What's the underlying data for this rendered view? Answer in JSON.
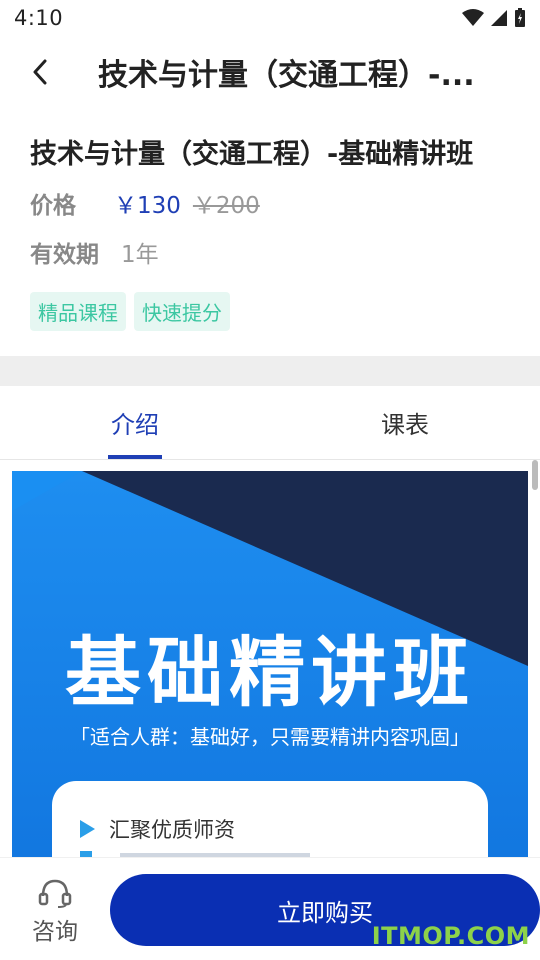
{
  "status": {
    "time": "4:10"
  },
  "nav": {
    "title": "技术与计量（交通工程）-..."
  },
  "course": {
    "title": "技术与计量（交通工程）-基础精讲班",
    "price_label": "价格",
    "price_now": "￥130",
    "price_old": "￥200",
    "validity_label": "有效期",
    "validity_value": "1年",
    "tags": [
      "精品课程",
      "快速提分"
    ]
  },
  "tabs": [
    {
      "label": "介绍",
      "active": true
    },
    {
      "label": "课表",
      "active": false
    }
  ],
  "banner": {
    "headline": "基础精讲班",
    "subtitle": "「适合人群：基础好，只需要精讲内容巩固」",
    "features": [
      "汇聚优质师资"
    ]
  },
  "bottom": {
    "consult_label": "咨询",
    "buy_label": "立即购买"
  },
  "watermark": "ITMOP.COM",
  "colors": {
    "accent": "#1f3fb5",
    "buy_button": "#0a2fb3",
    "tag_bg": "#e6f7f2",
    "tag_text": "#3cc7a2",
    "banner_blue": "#1e8ef0",
    "banner_navy": "#1a2a4f"
  }
}
